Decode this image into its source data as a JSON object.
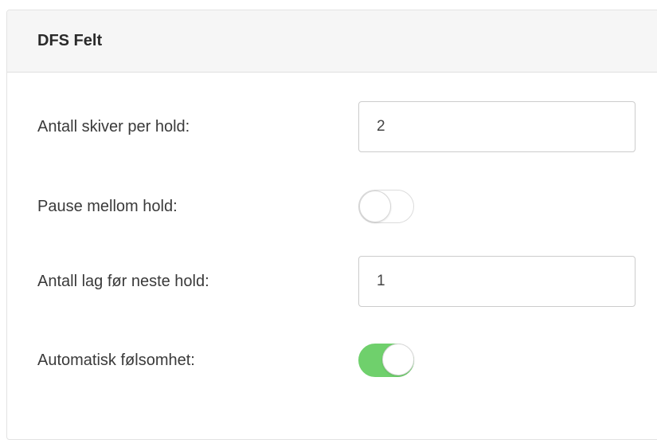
{
  "panel": {
    "title": "DFS Felt"
  },
  "settings": [
    {
      "label": "Antall skiver per hold:",
      "type": "input",
      "value": "2"
    },
    {
      "label": "Pause mellom hold:",
      "type": "toggle",
      "checked": false
    },
    {
      "label": "Antall lag før neste hold:",
      "type": "input",
      "value": "1"
    },
    {
      "label": "Automatisk følsomhet:",
      "type": "toggle",
      "checked": true
    }
  ],
  "colors": {
    "toggle_on": "#6fd06c",
    "header_bg": "#f6f6f6"
  }
}
